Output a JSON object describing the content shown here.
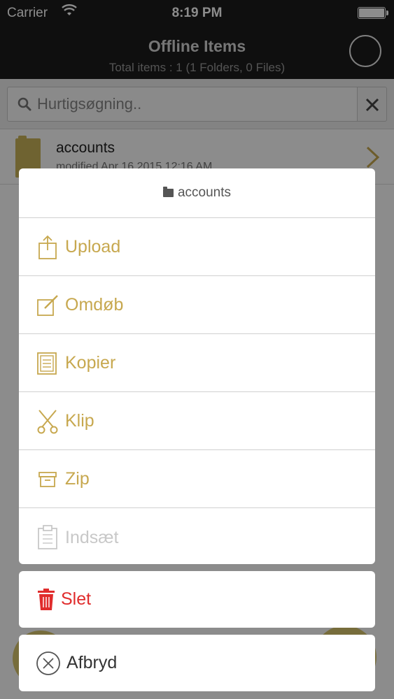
{
  "status_bar": {
    "carrier": "Carrier",
    "time": "8:19 PM"
  },
  "header": {
    "title": "Offline Items",
    "subtitle": "Total items : 1 (1 Folders, 0 Files)"
  },
  "search": {
    "placeholder": "Hurtigsøgning.."
  },
  "file_list": [
    {
      "name": "accounts",
      "meta": "modified Apr 16 2015 12:16 AM",
      "icon": "folder-icon"
    }
  ],
  "action_sheet": {
    "title": "accounts",
    "actions": [
      {
        "label": "Upload",
        "icon": "upload-icon",
        "enabled": true
      },
      {
        "label": "Omdøb",
        "icon": "rename-icon",
        "enabled": true
      },
      {
        "label": "Kopier",
        "icon": "copy-icon",
        "enabled": true
      },
      {
        "label": "Klip",
        "icon": "scissors-icon",
        "enabled": true
      },
      {
        "label": "Zip",
        "icon": "archive-icon",
        "enabled": true
      },
      {
        "label": "Indsæt",
        "icon": "paste-icon",
        "enabled": false
      }
    ],
    "delete_label": "Slet",
    "cancel_label": "Afbryd"
  },
  "colors": {
    "accent": "#c7a84f",
    "danger": "#e02c2c",
    "disabled": "#c8c8c8",
    "header_bg": "#1c1c1c"
  }
}
